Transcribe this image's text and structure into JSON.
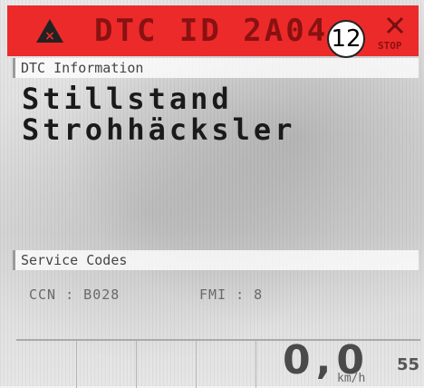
{
  "header": {
    "title": "DTC ID 2A04",
    "badge": "12",
    "warning_icon": "warning-triangle-icon",
    "stop_icon": "stop-cross-icon",
    "stop_label": "STOP",
    "color": "#ec2a2a"
  },
  "dtc_info": {
    "label": "DTC Information",
    "message_line1": "Stillstand",
    "message_line2": "Strohhäcksler"
  },
  "service": {
    "label": "Service Codes",
    "ccn": "CCN : B028",
    "fmi": "FMI : 8"
  },
  "footer": {
    "speed": "0,0",
    "unit": "km/h",
    "right_value": "55"
  }
}
